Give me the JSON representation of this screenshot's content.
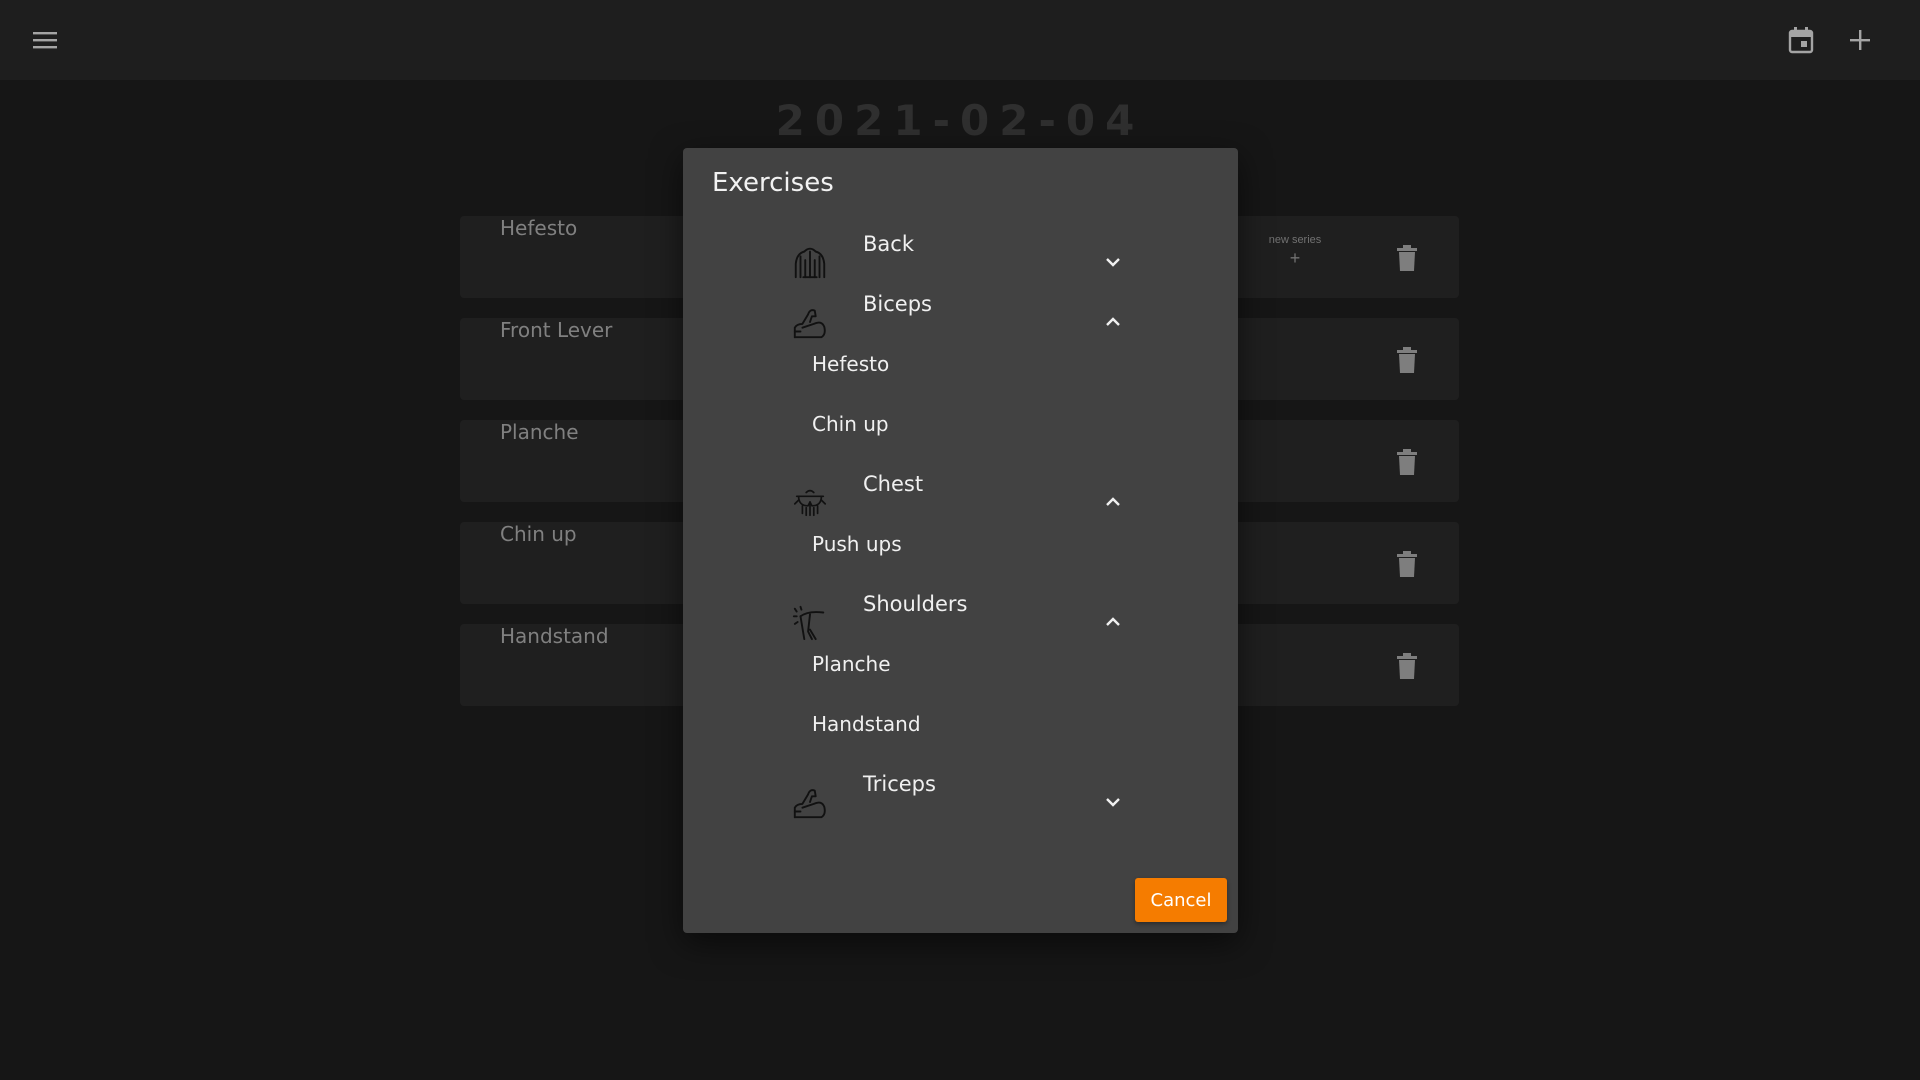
{
  "header": {
    "menu_icon": "hamburger-menu-icon",
    "calendar_icon": "calendar-icon",
    "add_icon": "plus-icon"
  },
  "date": "2021-02-04",
  "workouts": [
    {
      "name": "Hefesto",
      "new_series_label": "new series",
      "new_series_icon": "+"
    },
    {
      "name": "Front Lever"
    },
    {
      "name": "Planche"
    },
    {
      "name": "Chin up"
    },
    {
      "name": "Handstand"
    }
  ],
  "dialog": {
    "title": "Exercises",
    "groups": [
      {
        "label": "Back",
        "icon": "back-muscle-icon",
        "expanded": false,
        "exercises": []
      },
      {
        "label": "Biceps",
        "icon": "biceps-muscle-icon",
        "expanded": true,
        "exercises": [
          "Hefesto",
          "Chin up"
        ]
      },
      {
        "label": "Chest",
        "icon": "chest-muscle-icon",
        "expanded": true,
        "exercises": [
          "Push ups"
        ]
      },
      {
        "label": "Shoulders",
        "icon": "shoulders-muscle-icon",
        "expanded": true,
        "exercises": [
          "Planche",
          "Handstand"
        ]
      },
      {
        "label": "Triceps",
        "icon": "triceps-muscle-icon",
        "expanded": false,
        "exercises": []
      }
    ],
    "cancel_label": "Cancel"
  },
  "colors": {
    "background": "#1b1b1b",
    "topbar": "#252525",
    "card": "#262626",
    "dialog": "#424242",
    "accent": "#f57c00"
  }
}
